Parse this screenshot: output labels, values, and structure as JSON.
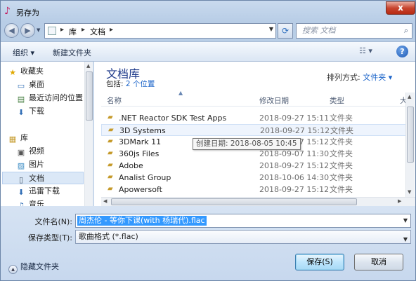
{
  "window": {
    "title": "另存为",
    "close_symbol": "x"
  },
  "nav": {
    "address_segments": [
      "库",
      "文档"
    ],
    "search_placeholder": "搜索 文档"
  },
  "toolbar": {
    "organize": "组织 ▾",
    "new_folder": "新建文件夹",
    "view_label": "☷ ▾",
    "help": "?"
  },
  "nav_pane": {
    "items": [
      {
        "label": "收藏夹",
        "icon": "star-icon"
      },
      {
        "label": "桌面",
        "icon": "desktop-icon"
      },
      {
        "label": "最近访问的位置",
        "icon": "recent-icon"
      },
      {
        "label": "下载",
        "icon": "download-icon"
      },
      {
        "label": "库",
        "icon": "library-icon"
      },
      {
        "label": "视频",
        "icon": "video-icon"
      },
      {
        "label": "图片",
        "icon": "picture-icon"
      },
      {
        "label": "文档",
        "icon": "document-icon"
      },
      {
        "label": "迅雷下载",
        "icon": "thunder-icon"
      },
      {
        "label": "音乐",
        "icon": "music-icon"
      }
    ]
  },
  "library": {
    "title": "文档库",
    "includes_prefix": "包括: ",
    "includes_link": "2 个位置",
    "arrange_label": "排列方式: ",
    "arrange_value": "文件夹 ▾"
  },
  "columns": {
    "name": "名称",
    "date": "修改日期",
    "type": "类型",
    "size": "大"
  },
  "files": [
    {
      "name": ".NET Reactor SDK Test Apps",
      "date": "2018-09-27 15:11",
      "type": "文件夹"
    },
    {
      "name": "3D Systems",
      "date": "2018-09-27 15:12",
      "type": "文件夹"
    },
    {
      "name": "3DMark 11",
      "date": "2018-09-27 15:12",
      "type": "文件夹"
    },
    {
      "name": "360js Files",
      "date": "2018-09-07 11:30",
      "type": "文件夹"
    },
    {
      "name": "Adobe",
      "date": "2018-09-27 15:12",
      "type": "文件夹"
    },
    {
      "name": "Analist Group",
      "date": "2018-10-06 14:30",
      "type": "文件夹"
    },
    {
      "name": "Apowersoft",
      "date": "2018-09-27 15:12",
      "type": "文件夹"
    }
  ],
  "tooltip": "创建日期: 2018-08-05 10:45",
  "form": {
    "filename_label": "文件名(N):",
    "filename_value": "周杰伦 - 等你下课(with 杨瑞代).flac",
    "filetype_label": "保存类型(T):",
    "filetype_value": "歌曲格式 (*.flac)"
  },
  "footer": {
    "hide_folders": "隐藏文件夹",
    "save": "保存(S)",
    "cancel": "取消"
  }
}
